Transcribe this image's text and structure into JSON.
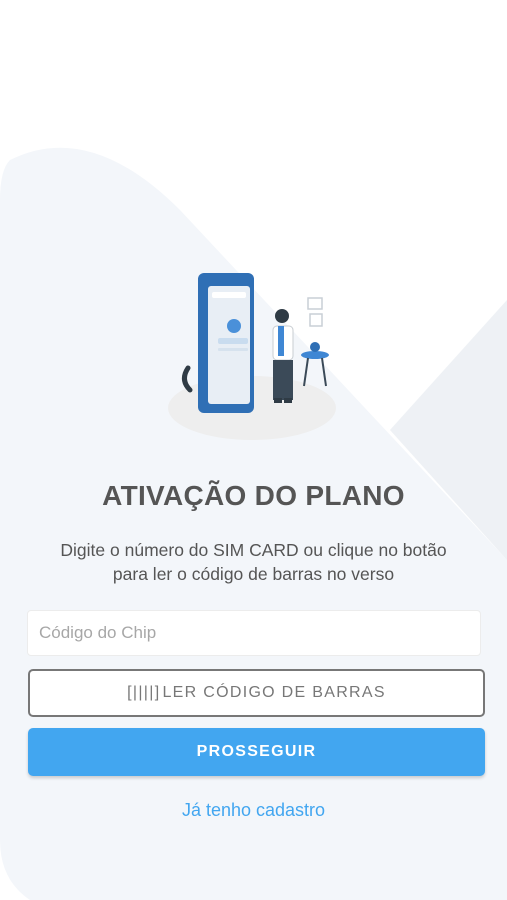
{
  "header": {
    "title": "ATIVAÇÃO DO PLANO",
    "subtitle_line1": "Digite o número do SIM CARD ou clique no botão",
    "subtitle_line2": "para ler o código de barras no verso"
  },
  "form": {
    "chip_placeholder": "Código do Chip",
    "chip_value": "",
    "barcode_icon_glyph": "[||||]",
    "barcode_button_label": "LER CÓDIGO DE BARRAS",
    "proceed_button_label": "PROSSEGUIR",
    "login_link_label": "Já tenho cadastro"
  },
  "colors": {
    "accent": "#42a6f0",
    "text": "#555555",
    "outline": "#777777",
    "background_shape": "#f1f5fa"
  },
  "illustration": {
    "icon": "phone-activation-illustration"
  }
}
